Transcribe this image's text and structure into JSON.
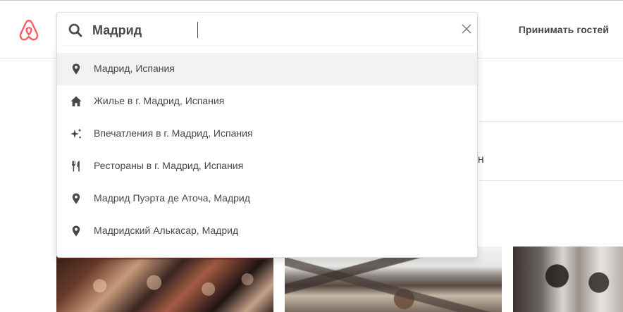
{
  "header": {
    "host_link": "Принимать гостей"
  },
  "search": {
    "value": "Мадрид"
  },
  "suggestions": [
    {
      "label": "Мадрид, Испания",
      "icon": "location-pin-icon"
    },
    {
      "label": "Жилье в г. Мадрид, Испания",
      "icon": "home-icon"
    },
    {
      "label": "Впечатления в г. Мадрид, Испания",
      "icon": "sparkle-icon"
    },
    {
      "label": "Рестораны в г. Мадрид, Испания",
      "icon": "fork-knife-icon"
    },
    {
      "label": "Мадрид Пуэрта де Аточа, Мадрид",
      "icon": "location-pin-icon"
    },
    {
      "label": "Мадридский Алькасар, Мадрид",
      "icon": "location-pin-icon"
    }
  ],
  "background": {
    "partial_text": "сен"
  },
  "colors": {
    "brand": "#FF5A5F",
    "text": "#484848",
    "active_row": "#F2F2F2"
  }
}
